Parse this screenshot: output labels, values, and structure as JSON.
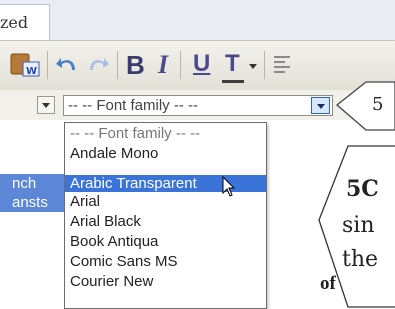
{
  "tab": {
    "label": "zed"
  },
  "toolbar": {
    "bold_label": "B",
    "italic_label": "I",
    "underline_label": "U",
    "textcolor_label": "T"
  },
  "font_family_select": {
    "value": "-- -- Font family -- --"
  },
  "dropdown": {
    "items": [
      "-- -- Font family -- --",
      "Andale Mono",
      "Arabic Transparent",
      "Arial",
      "Arial Black",
      "Book Antiqua",
      "Comic Sans MS",
      "Courier New"
    ],
    "selected_index": 2
  },
  "editor": {
    "highlight_lines": [
      "nch",
      "ansts"
    ],
    "body_text": "of t"
  },
  "callouts": {
    "top_number": "5",
    "big_title": "5C",
    "line2": "sin",
    "line3": "the"
  }
}
